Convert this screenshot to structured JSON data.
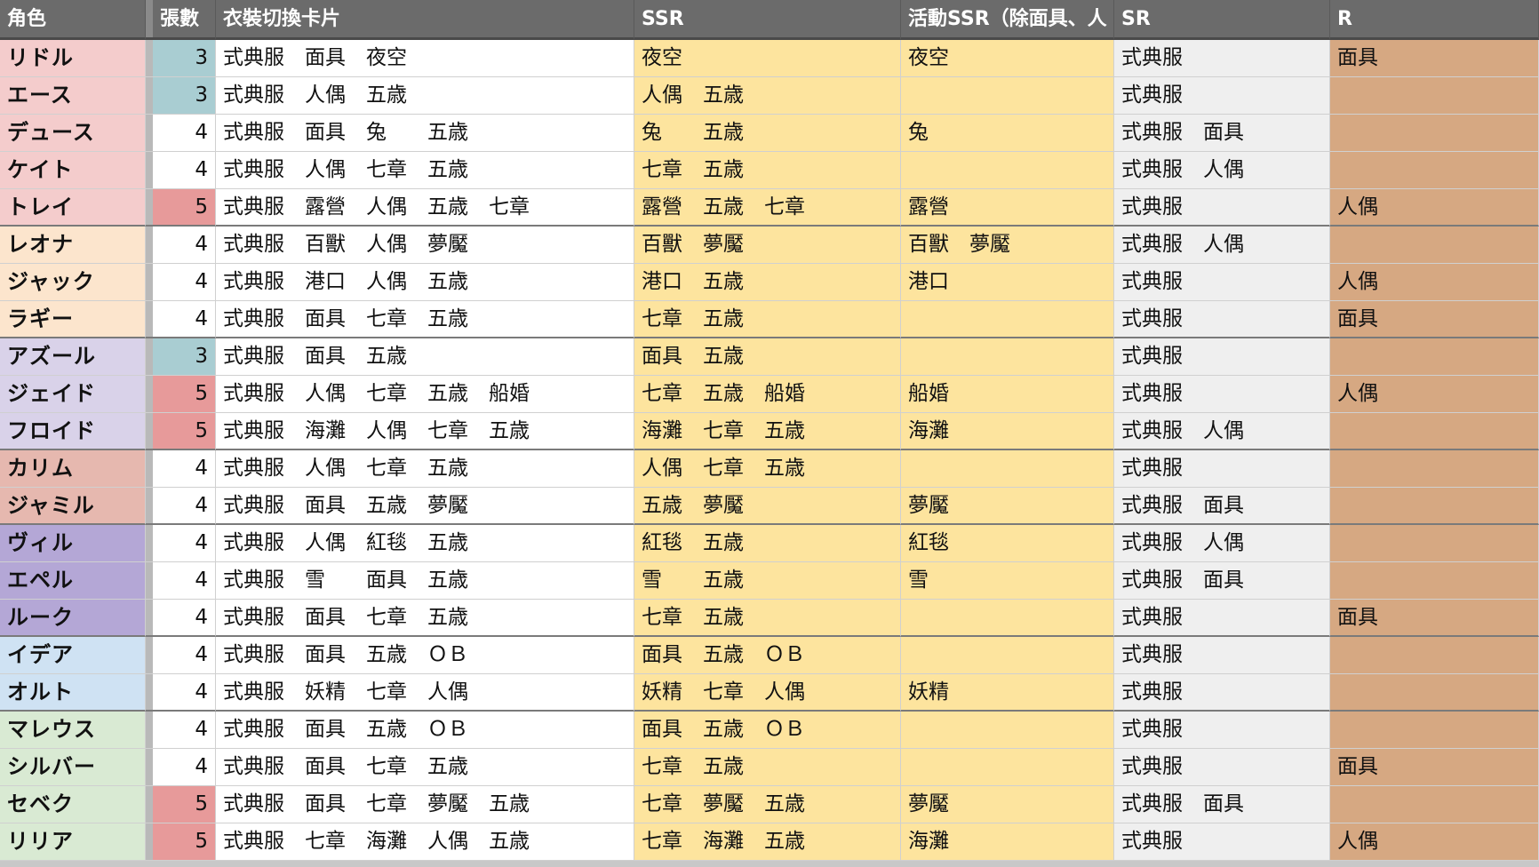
{
  "headers": {
    "name": "角色",
    "count": "張數",
    "all": "衣裝切換卡片",
    "ssr": "SSR",
    "event": "活動SSR（除面具、人",
    "sr": "SR",
    "r": "R"
  },
  "colors": {
    "header_bg": "#6b6b6b",
    "ssr_col": "#fde49e",
    "sr_col": "#efefef",
    "r_col": "#d6a882",
    "count_3": "#a9cdd2",
    "count_5": "#e79a9a"
  },
  "rows": [
    {
      "name": "リドル",
      "count": "3",
      "all": "式典服　面具　夜空",
      "ssr": "夜空",
      "event": "夜空",
      "sr": "式典服",
      "r": "面具",
      "color": "#f4cccc",
      "group_end": false
    },
    {
      "name": "エース",
      "count": "3",
      "all": "式典服　人偶　五歳",
      "ssr": "人偶　五歳",
      "event": "",
      "sr": "式典服",
      "r": "",
      "color": "#f4cccc",
      "group_end": false
    },
    {
      "name": "デュース",
      "count": "4",
      "all": "式典服　面具　兔　　五歳",
      "ssr": "兔　　五歳",
      "event": "兔",
      "sr": "式典服　面具",
      "r": "",
      "color": "#f4cccc",
      "group_end": false
    },
    {
      "name": "ケイト",
      "count": "4",
      "all": "式典服　人偶　七章　五歳",
      "ssr": "七章　五歳",
      "event": "",
      "sr": "式典服　人偶",
      "r": "",
      "color": "#f4cccc",
      "group_end": false
    },
    {
      "name": "トレイ",
      "count": "5",
      "all": "式典服　露營　人偶　五歳　七章",
      "ssr": "露營　五歳　七章",
      "event": "露營",
      "sr": "式典服",
      "r": "人偶",
      "color": "#f4cccc",
      "group_end": true
    },
    {
      "name": "レオナ",
      "count": "4",
      "all": "式典服　百獸　人偶　夢魘",
      "ssr": "百獸　夢魘",
      "event": "百獸　夢魘",
      "sr": "式典服　人偶",
      "r": "",
      "color": "#fce5cd",
      "group_end": false
    },
    {
      "name": "ジャック",
      "count": "4",
      "all": "式典服　港口　人偶　五歳",
      "ssr": "港口　五歳",
      "event": "港口",
      "sr": "式典服",
      "r": "人偶",
      "color": "#fce5cd",
      "group_end": false
    },
    {
      "name": "ラギー",
      "count": "4",
      "all": "式典服　面具　七章　五歳",
      "ssr": "七章　五歳",
      "event": "",
      "sr": "式典服",
      "r": "面具",
      "color": "#fce5cd",
      "group_end": true
    },
    {
      "name": "アズール",
      "count": "3",
      "all": "式典服　面具　五歳",
      "ssr": "面具　五歳",
      "event": "",
      "sr": "式典服",
      "r": "",
      "color": "#d9d2e9",
      "group_end": false
    },
    {
      "name": "ジェイド",
      "count": "5",
      "all": "式典服　人偶　七章　五歳　船婚",
      "ssr": "七章　五歳　船婚",
      "event": "船婚",
      "sr": "式典服",
      "r": "人偶",
      "color": "#d9d2e9",
      "group_end": false
    },
    {
      "name": "フロイド",
      "count": "5",
      "all": "式典服　海灘　人偶　七章　五歳",
      "ssr": "海灘　七章　五歳",
      "event": "海灘",
      "sr": "式典服　人偶",
      "r": "",
      "color": "#d9d2e9",
      "group_end": true
    },
    {
      "name": "カリム",
      "count": "4",
      "all": "式典服　人偶　七章　五歳",
      "ssr": "人偶　七章　五歳",
      "event": "",
      "sr": "式典服",
      "r": "",
      "color": "#e6b8af",
      "group_end": false
    },
    {
      "name": "ジャミル",
      "count": "4",
      "all": "式典服　面具　五歳　夢魘",
      "ssr": "五歳　夢魘",
      "event": "夢魘",
      "sr": "式典服　面具",
      "r": "",
      "color": "#e6b8af",
      "group_end": true
    },
    {
      "name": "ヴィル",
      "count": "4",
      "all": "式典服　人偶　紅毯　五歳",
      "ssr": "紅毯　五歳",
      "event": "紅毯",
      "sr": "式典服　人偶",
      "r": "",
      "color": "#b4a7d6",
      "group_end": false
    },
    {
      "name": "エペル",
      "count": "4",
      "all": "式典服　雪　　面具　五歳",
      "ssr": "雪　　五歳",
      "event": "雪",
      "sr": "式典服　面具",
      "r": "",
      "color": "#b4a7d6",
      "group_end": false
    },
    {
      "name": "ルーク",
      "count": "4",
      "all": "式典服　面具　七章　五歳",
      "ssr": "七章　五歳",
      "event": "",
      "sr": "式典服",
      "r": "面具",
      "color": "#b4a7d6",
      "group_end": true
    },
    {
      "name": "イデア",
      "count": "4",
      "all": "式典服　面具　五歳　ＯＢ",
      "ssr": "面具　五歳　ＯＢ",
      "event": "",
      "sr": "式典服",
      "r": "",
      "color": "#cfe2f3",
      "group_end": false
    },
    {
      "name": "オルト",
      "count": "4",
      "all": "式典服　妖精　七章　人偶",
      "ssr": "妖精　七章　人偶",
      "event": "妖精",
      "sr": "式典服",
      "r": "",
      "color": "#cfe2f3",
      "group_end": true
    },
    {
      "name": "マレウス",
      "count": "4",
      "all": "式典服　面具　五歳　ＯＢ",
      "ssr": "面具　五歳　ＯＢ",
      "event": "",
      "sr": "式典服",
      "r": "",
      "color": "#d9ead3",
      "group_end": false
    },
    {
      "name": "シルバー",
      "count": "4",
      "all": "式典服　面具　七章　五歳",
      "ssr": "七章　五歳",
      "event": "",
      "sr": "式典服",
      "r": "面具",
      "color": "#d9ead3",
      "group_end": false
    },
    {
      "name": "セベク",
      "count": "5",
      "all": "式典服　面具　七章　夢魘　五歳",
      "ssr": "七章　夢魘　五歳",
      "event": "夢魘",
      "sr": "式典服　面具",
      "r": "",
      "color": "#d9ead3",
      "group_end": false
    },
    {
      "name": "リリア",
      "count": "5",
      "all": "式典服　七章　海灘　人偶　五歳",
      "ssr": "七章　海灘　五歳",
      "event": "海灘",
      "sr": "式典服",
      "r": "人偶",
      "color": "#d9ead3",
      "group_end": false
    }
  ]
}
